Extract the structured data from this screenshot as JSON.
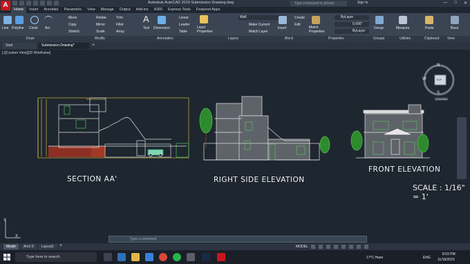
{
  "app": {
    "logo": "A",
    "title": "Autodesk AutoCAD 2019    Submission Drawing.dwg",
    "search_placeholder": "Type a keyword or phrase",
    "signin": "Sign In"
  },
  "ribbon_tabs": [
    "Home",
    "Insert",
    "Annotate",
    "Parametric",
    "View",
    "Manage",
    "Output",
    "Add-ins",
    "A360",
    "Express Tools",
    "Featured Apps"
  ],
  "ribbon": {
    "draw": [
      "Line",
      "Polyline",
      "Circle",
      "Arc"
    ],
    "modify": [
      "Move",
      "Rotate",
      "Trim",
      "Copy",
      "Mirror",
      "Fillet",
      "Stretch",
      "Scale",
      "Array"
    ],
    "annotation": [
      "Text",
      "Dimension",
      "Linear",
      "Leader",
      "Table"
    ],
    "layers": [
      "Layer Properties",
      "Wall",
      "Make Current",
      "Match Layer"
    ],
    "block": [
      "Insert",
      "Create",
      "Edit"
    ],
    "properties": [
      "Match Properties",
      "ByLayer",
      "0.000\"",
      "ByLayer"
    ],
    "groups": [
      "Group"
    ],
    "utilities": [
      "Measure"
    ],
    "clipboard": [
      "Paste"
    ],
    "view": [
      "Base"
    ]
  },
  "panels": [
    "Draw",
    "Modify",
    "Annotation",
    "Layers",
    "Block",
    "Properties",
    "Groups",
    "Utilities",
    "Clipboard",
    "View"
  ],
  "doc_tabs": [
    "Start",
    "Submission Drawing*"
  ],
  "viewport_label": "[-][Custom View][2D Wireframe]",
  "viewcube": {
    "n": "N",
    "s": "S",
    "w": "W",
    "top": "TOP",
    "wcs": "Unnamed"
  },
  "drawings": {
    "section": "SECTION AA'",
    "side": "RIGHT SIDE ELEVATION",
    "front": "FRONT ELEVATION",
    "scale": "SCALE :  1/16\" = 1'"
  },
  "ucs": {
    "y": "Y",
    "x": "X"
  },
  "command_placeholder": "Type a command",
  "layout_tabs": [
    "Model",
    "Arch D",
    "Layout1"
  ],
  "status": {
    "model": "MODEL"
  },
  "taskbar": {
    "search": "Type here to search",
    "weather": "17°C  Haze",
    "lang": "ENG",
    "time": "8:03 PM",
    "date": "11/18/2023"
  }
}
